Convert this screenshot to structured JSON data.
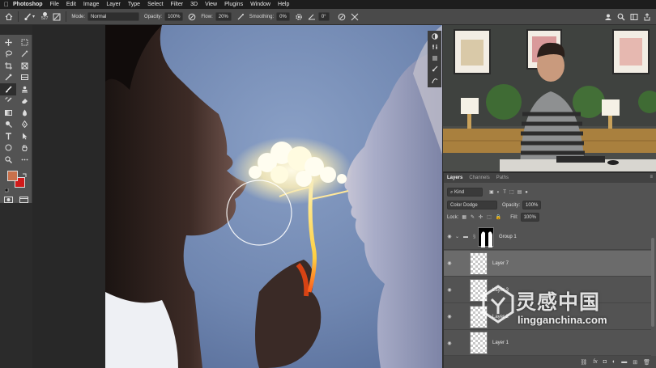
{
  "menubar": {
    "app": "Photoshop",
    "items": [
      "File",
      "Edit",
      "Image",
      "Layer",
      "Type",
      "Select",
      "Filter",
      "3D",
      "View",
      "Plugins",
      "Window",
      "Help"
    ]
  },
  "options": {
    "brush_size": "527",
    "mode_label": "Mode:",
    "mode_value": "Normal",
    "opacity_label": "Opacity:",
    "opacity_value": "100%",
    "flow_label": "Flow:",
    "flow_value": "20%",
    "smoothing_label": "Smoothing:",
    "smoothing_value": "0%",
    "angle_value": "0°"
  },
  "panel": {
    "tabs": [
      "Layers",
      "Channels",
      "Paths"
    ],
    "kind_label": "Kind",
    "blend_mode": "Color Dodge",
    "opacity_label": "Opacity:",
    "opacity_value": "100%",
    "lock_label": "Lock:",
    "fill_label": "Fill:",
    "fill_value": "100%",
    "layers": [
      {
        "name": "Group 1"
      },
      {
        "name": "Layer 7"
      },
      {
        "name": "Layer 3"
      },
      {
        "name": "Layer 2"
      },
      {
        "name": "Layer 1"
      }
    ]
  },
  "watermark": {
    "cn": "灵感中国",
    "en": "lingganchina.com"
  },
  "colors": {
    "foreground": "#c8714c",
    "background": "#d11a1a",
    "menubar": "#1d1d1d",
    "panel": "#535353"
  },
  "icons": [
    "apple-icon",
    "home-icon",
    "brush-icon",
    "search-icon",
    "share-icon"
  ]
}
